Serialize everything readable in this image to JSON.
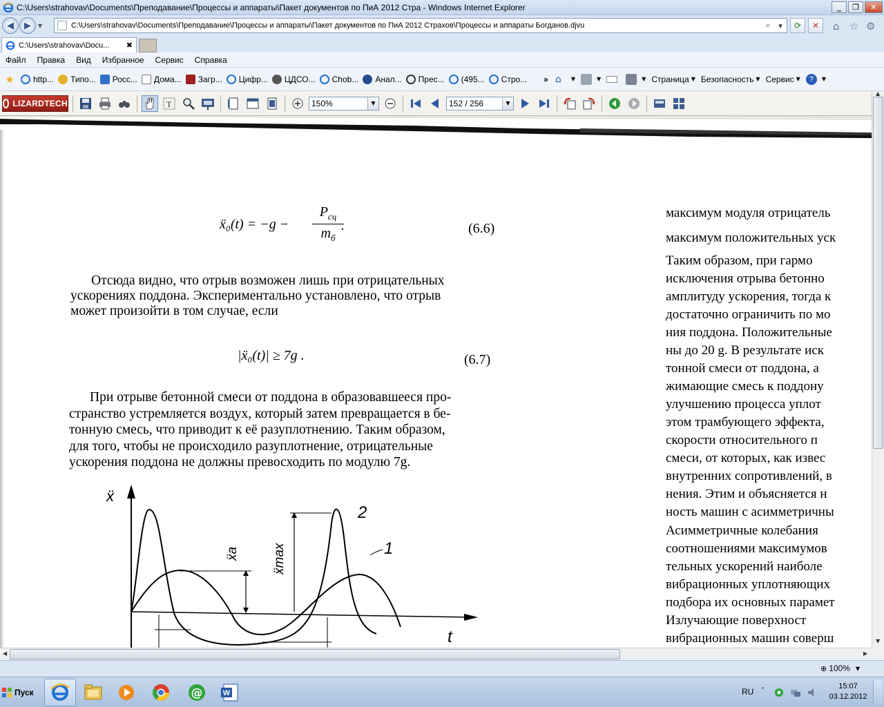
{
  "window": {
    "title": "C:\\Users\\strahovav\\Documents\\Преподавание\\Процессы и аппараты\\Пакет документов по ПиА 2012 Стра - Windows Internet Explorer"
  },
  "address": {
    "url": "C:\\Users\\strahovav\\Documents\\Преподавание\\Процессы и аппараты\\Пакет документов по ПиА 2012 Страхов\\Процессы и аппараты Богданов.djvu"
  },
  "tab": {
    "label": "C:\\Users\\strahovav\\Docu...",
    "close": "✖"
  },
  "menu": [
    "Файл",
    "Правка",
    "Вид",
    "Избранное",
    "Сервис",
    "Справка"
  ],
  "favorites": [
    "http...",
    "Типо...",
    "Росс...",
    "Дома...",
    "Загр...",
    "Цифр...",
    "ЦДСО...",
    "Chob...",
    "Анал...",
    "Прес...",
    "(495...",
    "Стро..."
  ],
  "command_bar": {
    "page": "Страница",
    "safety": "Безопасность",
    "service": "Сервис",
    "more": "»"
  },
  "viewer": {
    "logo": "LIZARDTECH",
    "zoom": "150%",
    "page": "152 / 256"
  },
  "document": {
    "eq66_lhs": "ẍ₀(t) = −g − ",
    "eq66_num": "P",
    "eq66_num_sub": "сц",
    "eq66_den": "m",
    "eq66_den_sub": "б",
    "eq66_dot": ".",
    "eq66_label": "(6.6)",
    "para1": [
      "Отсюда видно, что отрыв возможен лишь при отрицательных",
      "ускорениях поддона. Экспериментально установлено, что отрыв",
      "может произойти в том случае, если"
    ],
    "eq67": "|ẍ₀(t)| ≥ 7g .",
    "eq67_label": "(6.7)",
    "para2": [
      "При отрыве бетонной смеси от поддона в образовавшееся про-",
      "странство устремляется воздух, который затем превращается в бе-",
      "тонную смесь, что приводит к её разуплотнению. Таким образом,",
      "для того, чтобы не происходило разуплотнение, отрицательные",
      "ускорения поддона не должны превосходить по модулю 7g."
    ],
    "figure": {
      "y_axis": "ẍ",
      "x_axis": "t",
      "label_xa": "ẍа",
      "label_xmax": "ẍmax",
      "curve2": "2",
      "curve1": "1"
    },
    "right_column": [
      "максимум модуля отрицатель",
      "максимум положительных уск",
      "   Таким образом, при гармо",
      "исключения отрыва бетонно",
      "амплитуду ускорения, тогда к",
      "достаточно ограничить по мо",
      "ния поддона. Положительные",
      "ны до 20 g. В результате иск",
      "тонной смеси от поддона, а",
      "жимающие смесь к поддону",
      "улучшению процесса уплот",
      "этом трамбующего эффекта,",
      "скорости относительного п",
      "смеси, от которых, как извес",
      "внутренних сопротивлений, в",
      "нения. Этим и объясняется н",
      "ность машин с асимметричны",
      "   Асимметричные колебания",
      "соотношениями максимумов",
      "тельных ускорений наиболе",
      "вибрационных уплотняющих",
      "подбора их основных парамет",
      "   Излучающие  поверхност",
      "вибрационных машин соверш"
    ]
  },
  "status": {
    "zoom": "100%"
  },
  "taskbar": {
    "start": "Пуск",
    "lang": "RU",
    "time": "15:07",
    "date": "03.12.2012"
  },
  "colors": {
    "ie_blue": "#1f6fd1",
    "lizard_red": "#b32b20"
  }
}
